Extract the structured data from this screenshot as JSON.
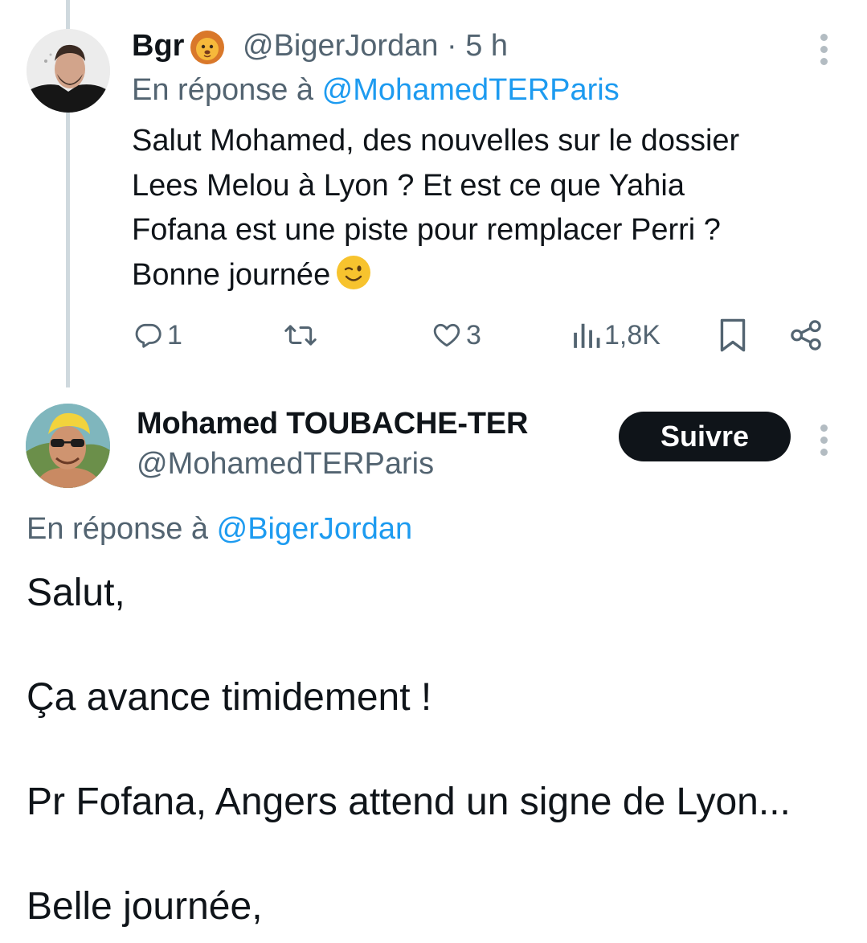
{
  "reply_tweet": {
    "author_name": "Bgr",
    "author_emoji": "lion-face-emoji",
    "handle_time": "@BigerJordan · 5 h",
    "reply_prefix": "En réponse à",
    "reply_to": "@MohamedTERParis",
    "text": "Salut Mohamed, des nouvelles sur le dossier\nLees Melou à Lyon ? Et est ce que Yahia\nFofana est une piste pour remplacer Perri ?\nBonne journée",
    "text_emoji": "winking-face-emoji",
    "actions": {
      "reply_count": "1",
      "retweet_count": "",
      "like_count": "3",
      "views_count": "1,8K"
    }
  },
  "main_tweet": {
    "author_name": "Mohamed TOUBACHE-TER",
    "handle": "@MohamedTERParis",
    "follow_label": "Suivre",
    "reply_prefix": "En réponse à",
    "reply_to": "@BigerJordan",
    "paragraphs": [
      "Salut,",
      "Ça avance timidement !",
      "Pr Fofana, Angers attend un signe de Lyon...",
      "Belle journée,"
    ]
  },
  "colors": {
    "text": "#0f1419",
    "secondary": "#536471",
    "link": "#1d9bf0",
    "thread_line": "#cfd9de",
    "follow_bg": "#0f1419"
  }
}
